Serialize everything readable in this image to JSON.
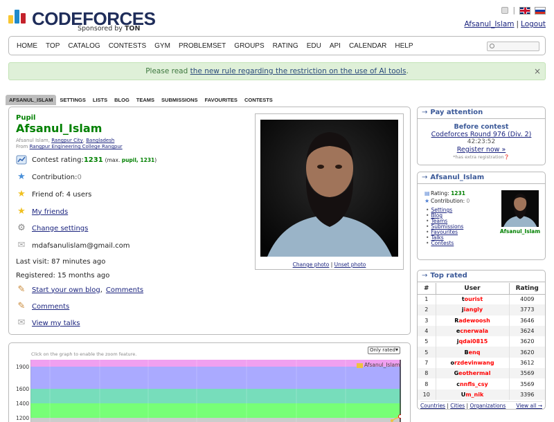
{
  "header": {
    "logo_text": "CODEFORCES",
    "sponsor_prefix": "Sponsored by",
    "sponsor_name": "TON",
    "user_link": "Afsanul_Islam",
    "logout": "Logout",
    "logo_colors": [
      "#f8c630",
      "#1f8acb",
      "#c4222c"
    ]
  },
  "menu": {
    "items": [
      "HOME",
      "TOP",
      "CATALOG",
      "CONTESTS",
      "GYM",
      "PROBLEMSET",
      "GROUPS",
      "RATING",
      "EDU",
      "API",
      "CALENDAR",
      "HELP"
    ]
  },
  "notice": {
    "prefix": "Please read ",
    "link": "the new rule regarding the restriction on the use of AI tools",
    "suffix": ".",
    "close": "×"
  },
  "submenu": {
    "items": [
      "AFSANUL_ISLAM",
      "SETTINGS",
      "LISTS",
      "BLOG",
      "TEAMS",
      "SUBMISSIONS",
      "FAVOURITES",
      "CONTESTS"
    ]
  },
  "profile": {
    "rank": "Pupil",
    "handle": "Afsanul_Islam",
    "real_name": "Afsanul Islam, ",
    "city": "Rangpur City",
    "country": "Bangladesh",
    "from_label": "From ",
    "org": "Rangpur Engineering College Rangpur",
    "contest_rating_label": "Contest rating: ",
    "rating": "1231",
    "max_prefix": "(max. ",
    "max_rank": "pupil, 1231",
    "max_suffix": ")",
    "contribution_label": "Contribution: ",
    "contribution": "0",
    "friend_of": "Friend of: 4 users",
    "my_friends": "My friends",
    "change_settings": "Change settings",
    "email": "mdafsanulislam@gmail.com",
    "last_visit": "Last visit: 87 minutes ago",
    "registered": "Registered: 15 months ago",
    "blog_start": "Start your own blog",
    "blog_comments": "Comments",
    "comments": "Comments",
    "talks": "View my talks",
    "change_photo": "Change photo",
    "unset_photo": "Unset photo",
    "sep": " | "
  },
  "graph": {
    "hint": "Click on the graph to enable the zoom feature.",
    "select_value": "Only rated",
    "legend": "Afsanul_Islam",
    "yticks": [
      "1900",
      "1600",
      "1400",
      "1200"
    ]
  },
  "sidebar": {
    "attention_title": "Pay attention",
    "before_contest": "Before contest",
    "contest_name": "Codeforces Round 976 (Div. 2)",
    "timer": "42:23:52",
    "register": "Register now »",
    "extra": "*has extra registration",
    "me_title": "Afsanul_Islam",
    "me_rating_label": "Rating: ",
    "me_rating": "1231",
    "me_contribution_label": "Contribution: ",
    "me_contribution": "0",
    "me_links": [
      "Settings",
      "Blog",
      "Teams",
      "Submissions",
      "Favourites",
      "Talks",
      "Contests"
    ],
    "me_name": "Afsanul_Islam",
    "top_title": "Top rated",
    "top_headers": [
      "#",
      "User",
      "Rating"
    ],
    "top_rows": [
      {
        "rank": "1",
        "first": "t",
        "rest": "ourist",
        "rating": "4009"
      },
      {
        "rank": "2",
        "first": "j",
        "rest": "iangly",
        "rating": "3773"
      },
      {
        "rank": "3",
        "first": "R",
        "rest": "adewoosh",
        "rating": "3646"
      },
      {
        "rank": "4",
        "first": "e",
        "rest": "cnerwala",
        "rating": "3624"
      },
      {
        "rank": "5",
        "first": "j",
        "rest": "qdai0815",
        "rating": "3620"
      },
      {
        "rank": "5",
        "first": "B",
        "rest": "enq",
        "rating": "3620"
      },
      {
        "rank": "7",
        "first": "o",
        "rest": "rzdevinwang",
        "rating": "3612"
      },
      {
        "rank": "8",
        "first": "G",
        "rest": "eothermal",
        "rating": "3569"
      },
      {
        "rank": "8",
        "first": "c",
        "rest": "nnfls_csy",
        "rating": "3569"
      },
      {
        "rank": "10",
        "first": "U",
        "rest": "m_nik",
        "rating": "3396"
      }
    ],
    "countries": "Countries",
    "cities": "Cities",
    "organizations": "Organizations",
    "view_all": "View all →"
  }
}
